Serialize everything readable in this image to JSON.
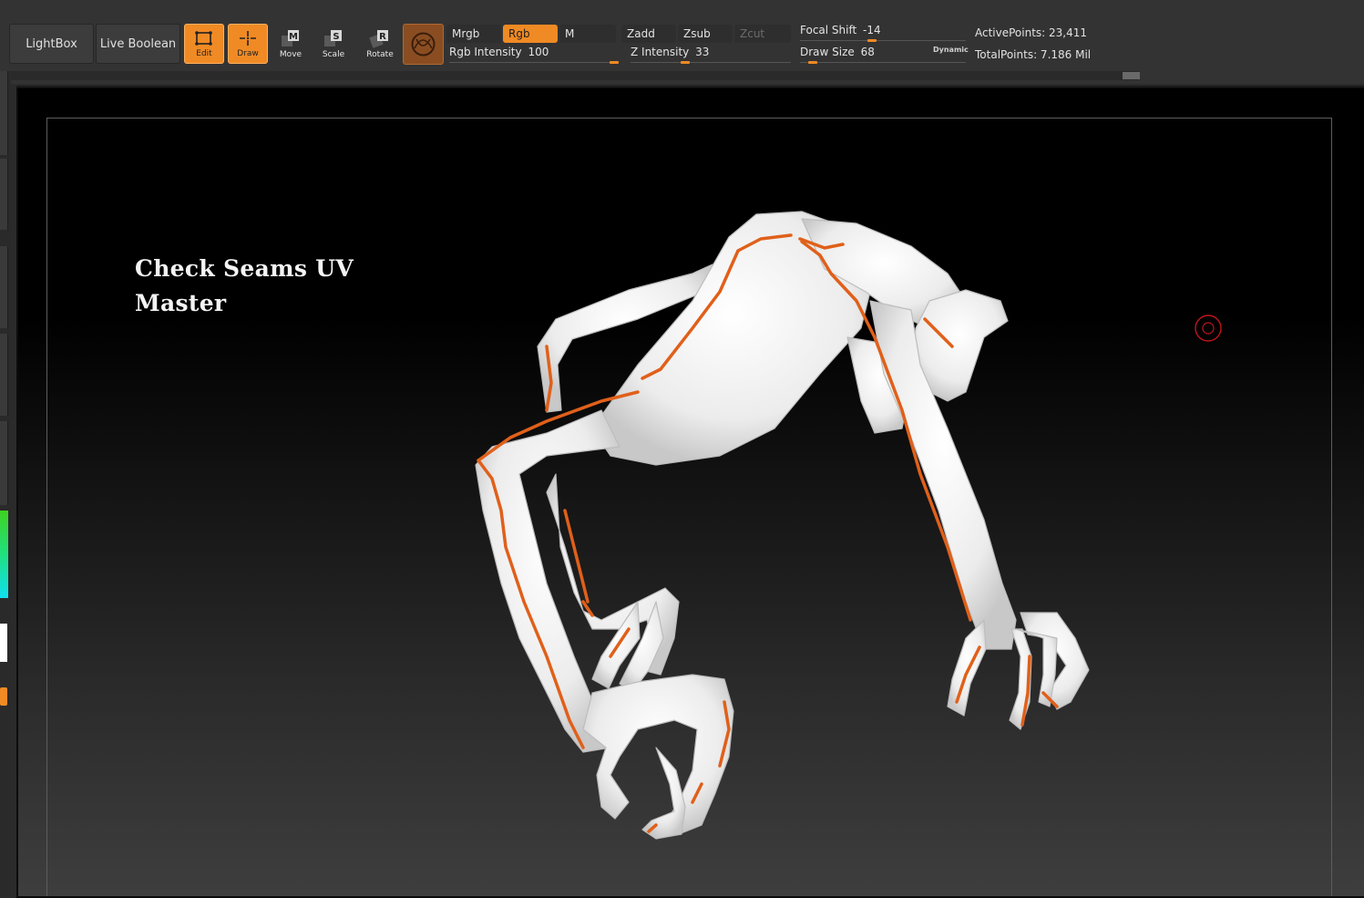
{
  "toolbar": {
    "lightbox": "LightBox",
    "live_boolean": "Live Boolean",
    "edit": "Edit",
    "draw": "Draw",
    "move": "Move",
    "scale": "Scale",
    "rotate": "Rotate",
    "move_letter": "M",
    "scale_letter": "S",
    "rotate_letter": "R",
    "mrgb": "Mrgb",
    "rgb": "Rgb",
    "m": "M",
    "zadd": "Zadd",
    "zsub": "Zsub",
    "zcut": "Zcut",
    "rgb_intensity_label": "Rgb Intensity",
    "rgb_intensity_value": "100",
    "rgb_intensity": 1.0,
    "z_intensity_label": "Z Intensity",
    "z_intensity_value": "33",
    "z_intensity": 0.33,
    "focal_shift_label": "Focal Shift",
    "focal_shift_value": "-14",
    "focal_shift": 0.43,
    "draw_size_label": "Draw Size",
    "draw_size_value": "68",
    "draw_size": 0.05,
    "dynamic": "Dynamic"
  },
  "stats": {
    "active_points": "ActivePoints: 23,411",
    "total_points": "TotalPoints: 7.186 Mil"
  },
  "viewport": {
    "annotation_line1": "Check Seams UV",
    "annotation_line2": "Master"
  },
  "colors": {
    "accent": "#f08a24",
    "seam": "#e0601a",
    "model": "#f2f2f2",
    "cursor": "#c0141c"
  },
  "icons": {
    "material": "material-sphere-icon",
    "cursor": "brush-cursor-icon"
  }
}
